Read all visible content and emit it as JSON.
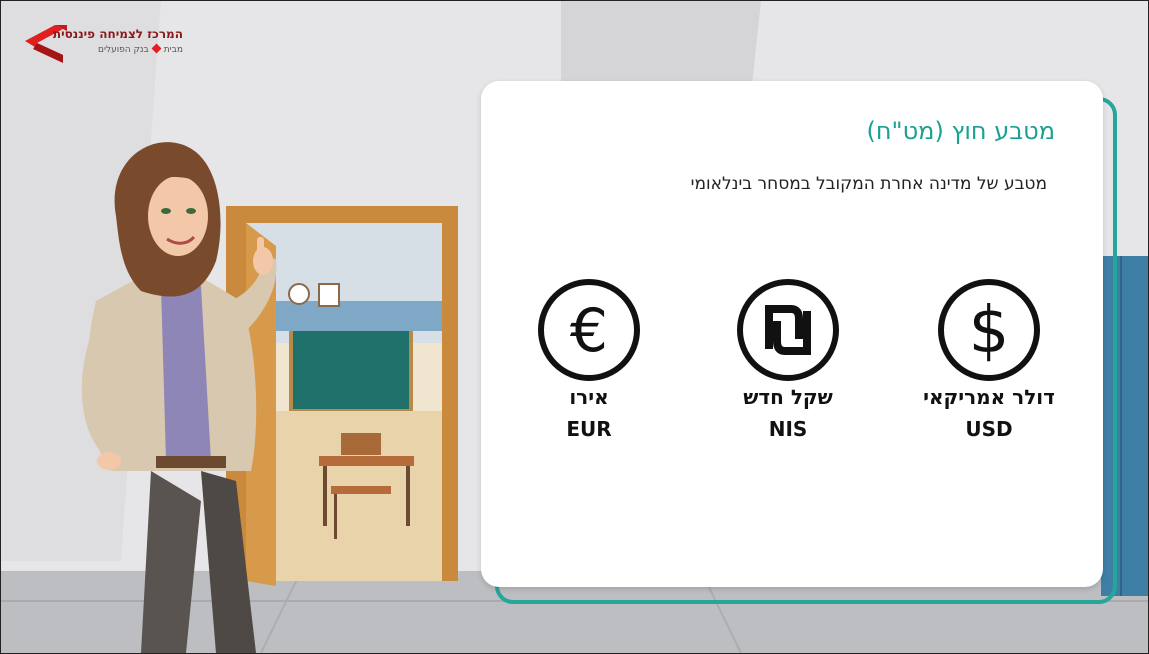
{
  "logo": {
    "title": "המרכז לצמיחה פיננסית",
    "subtitle_prefix": "מבית",
    "subtitle_bank": "בנק הפועלים",
    "icon": "red-chevron-logo"
  },
  "card": {
    "title": "מטבע חוץ (מט\"ח)",
    "description": "מטבע של מדינה אחרת המקובל במסחר בינלאומי",
    "currencies": [
      {
        "name": "דולר אמריקאי",
        "code": "USD",
        "icon": "dollar-icon"
      },
      {
        "name": "שקל חדש",
        "code": "NIS",
        "icon": "shekel-icon"
      },
      {
        "name": "אירו",
        "code": "EUR",
        "icon": "euro-icon"
      }
    ]
  },
  "colors": {
    "accent": "#1aa192",
    "card_border": "#26a69a",
    "logo_red": "#e02020"
  }
}
